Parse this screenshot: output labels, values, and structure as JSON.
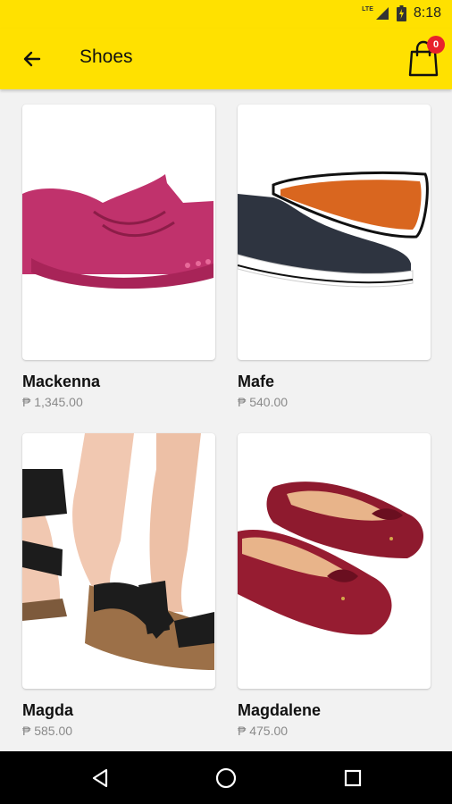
{
  "status_bar": {
    "network": "LTE",
    "time": "8:18"
  },
  "app_bar": {
    "title": "Shoes",
    "cart_count": "0"
  },
  "products": [
    {
      "name": "Mackenna",
      "price": "₱ 1,345.00"
    },
    {
      "name": "Mafe",
      "price": "₱ 540.00"
    },
    {
      "name": "Magda",
      "price": "₱ 585.00"
    },
    {
      "name": "Magdalene",
      "price": "₱ 475.00"
    }
  ],
  "colors": {
    "accent": "#ffe100",
    "badge": "#e8212c"
  }
}
